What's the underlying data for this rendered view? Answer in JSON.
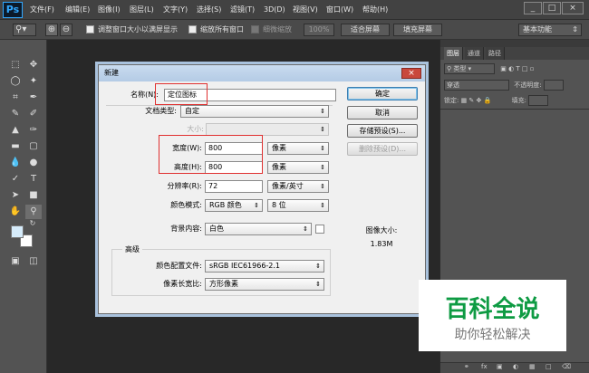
{
  "app": {
    "logo": "Ps"
  },
  "menubar": {
    "items": [
      "文件(F)",
      "编辑(E)",
      "图像(I)",
      "图层(L)",
      "文字(Y)",
      "选择(S)",
      "滤镜(T)",
      "3D(D)",
      "视图(V)",
      "窗口(W)",
      "帮助(H)"
    ],
    "win_min": "_",
    "win_max": "□",
    "win_close": "×"
  },
  "options": {
    "fit_window": "调整窗口大小以满屏显示",
    "zoom_all": "缩放所有窗口",
    "scrubby": "细微缩放",
    "zoom_pct": "100%",
    "fit_screen": "适合屏幕",
    "fill_screen": "填充屏幕",
    "workspace": "基本功能"
  },
  "panel": {
    "tabs": [
      "图层",
      "通道",
      "路径"
    ],
    "kind": "类型",
    "blend": "穿透",
    "opacity_label": "不透明度:",
    "lock_label": "锁定:",
    "fill_label": "填充:"
  },
  "dialog": {
    "title": "新建",
    "close": "×",
    "name_label": "名称(N):",
    "name_value": "定位图标",
    "preset_label": "文档类型:",
    "preset_value": "自定",
    "size_label": "大小:",
    "width_label": "宽度(W):",
    "width_value": "800",
    "width_unit": "像素",
    "height_label": "高度(H):",
    "height_value": "800",
    "height_unit": "像素",
    "res_label": "分辨率(R):",
    "res_value": "72",
    "res_unit": "像素/英寸",
    "mode_label": "颜色模式:",
    "mode_value": "RGB 颜色",
    "bits_value": "8 位",
    "bg_label": "背景内容:",
    "bg_value": "白色",
    "advanced_label": "高级",
    "profile_label": "颜色配置文件:",
    "profile_value": "sRGB IEC61966-2.1",
    "aspect_label": "像素长宽比:",
    "aspect_value": "方形像素",
    "ok": "确定",
    "cancel": "取消",
    "save_preset": "存储预设(S)...",
    "delete_preset": "删除预设(D)...",
    "image_size_label": "图像大小:",
    "image_size_value": "1.83M"
  },
  "watermark": {
    "title": "百科全说",
    "subtitle": "助你轻松解决"
  },
  "colors": {
    "fg": "#d6ecfb",
    "bg": "#ffffff",
    "watermark_green": "#0e9b43"
  }
}
